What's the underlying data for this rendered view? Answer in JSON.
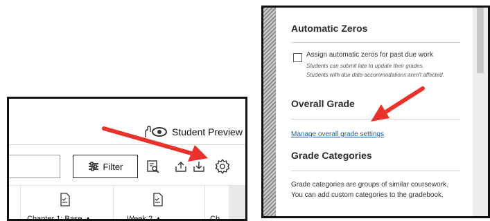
{
  "gradebook": {
    "student_preview_label": "Student Preview",
    "filter_label": "Filter",
    "columns": [
      "Chapter 1: Base",
      "Week 2",
      "Ch"
    ]
  },
  "settings": {
    "automatic_zeros": {
      "title": "Automatic Zeros",
      "checkbox_label": "Assign automatic zeros for past due work",
      "helper_line1": "Students can submit late to update their grades.",
      "helper_line2": "Students with due date accommodations aren't affected."
    },
    "overall_grade": {
      "title": "Overall Grade",
      "link": "Manage overall grade settings"
    },
    "grade_categories": {
      "title": "Grade Categories",
      "desc_line1": "Grade categories are groups of similar coursework.",
      "desc_line2": "You can add custom categories to the gradebook."
    }
  },
  "colors": {
    "arrow": "#e8322b",
    "link": "#1a5fa8"
  }
}
